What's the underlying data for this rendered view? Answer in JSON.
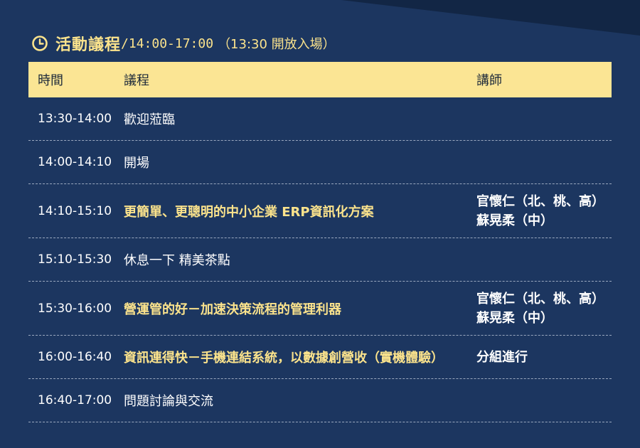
{
  "header": {
    "title": "活動議程",
    "time": "/14:00-17:00",
    "note": "（13:30 開放入場）",
    "icon": "clock-icon",
    "accent_color": "#fbe38c"
  },
  "table": {
    "columns": [
      "時間",
      "議程",
      "講師"
    ],
    "rows": [
      {
        "time": "13:30-14:00",
        "agenda": "歡迎蒞臨",
        "highlight": false,
        "speaker": []
      },
      {
        "time": "14:00-14:10",
        "agenda": "開場",
        "highlight": false,
        "speaker": []
      },
      {
        "time": "14:10-15:10",
        "agenda": "更簡單、更聰明的中小企業 ERP資訊化方案",
        "highlight": true,
        "speaker": [
          "官懷仁（北、桃、高）",
          "蘇晃柔（中）"
        ]
      },
      {
        "time": "15:10-15:30",
        "agenda": "休息一下  精美茶點",
        "highlight": false,
        "speaker": []
      },
      {
        "time": "15:30-16:00",
        "agenda": "營運管的好－加速決策流程的管理利器",
        "highlight": true,
        "speaker": [
          "官懷仁（北、桃、高）",
          "蘇晃柔（中）"
        ]
      },
      {
        "time": "16:00-16:40",
        "agenda": "資訊連得快－手機連結系統，以數據創營收（實機體驗）",
        "highlight": true,
        "speaker": [
          "分組進行"
        ]
      },
      {
        "time": "16:40-17:00",
        "agenda": "問題討論與交流",
        "highlight": false,
        "speaker": []
      }
    ]
  }
}
